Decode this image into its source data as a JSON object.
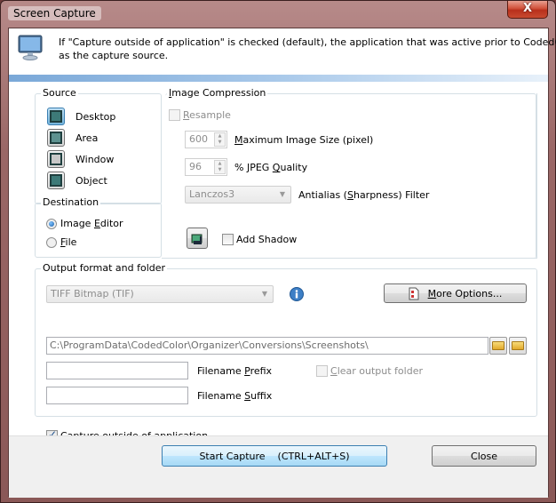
{
  "window": {
    "title": "Screen Capture",
    "close_label": "X"
  },
  "header": {
    "icon": "monitor-icon",
    "line1": "If \"Capture outside of application\" is checked (default), the application that was active prior to CodedColor is used",
    "line2": "as the capture source."
  },
  "source": {
    "label": "Source",
    "items": [
      {
        "label": "Desktop",
        "icon": "desktop-capture-icon",
        "active": true
      },
      {
        "label": "Area",
        "icon": "area-capture-icon",
        "active": false
      },
      {
        "label": "Window",
        "icon": "window-capture-icon",
        "active": false
      },
      {
        "label": "Object",
        "icon": "object-capture-icon",
        "active": false
      }
    ]
  },
  "destination": {
    "label": "Destination",
    "options": [
      {
        "label_pre": "Image ",
        "label_u": "E",
        "label_post": "ditor",
        "checked": true
      },
      {
        "label_pre": "",
        "label_u": "F",
        "label_post": "ile",
        "checked": false
      }
    ]
  },
  "compression": {
    "label_u": "I",
    "label_post": "mage Compression",
    "resample": {
      "label_u": "R",
      "label_post": "esample",
      "checked": false,
      "disabled": true
    },
    "max_size": {
      "value": "600",
      "label_u": "M",
      "label_post": "aximum Image Size (pixel)"
    },
    "jpeg_quality": {
      "value": "96",
      "label_pre": "% JPEG ",
      "label_u": "Q",
      "label_post": "uality"
    },
    "filter": {
      "value": "Lanczos3",
      "label_pre": "Antialias (",
      "label_u": "S",
      "label_post": "harpness) Filter"
    },
    "shadow_button_icon": "image-icon",
    "add_shadow": {
      "label": "Add Shadow",
      "checked": false
    }
  },
  "output": {
    "label": "Output format and folder",
    "format": "TIFF Bitmap (TIF)",
    "info_icon": "info-icon",
    "more_options": {
      "label_u": "M",
      "label_post": "ore Options...",
      "icon": "options-icon"
    },
    "folder_path": "C:\\ProgramData\\CodedColor\\Organizer\\Conversions\\Screenshots\\",
    "browse_icon": "folder-open-icon",
    "new_folder_icon": "folder-new-icon",
    "prefix": {
      "value": "",
      "label_pre": "Filename ",
      "label_u": "P",
      "label_post": "refix"
    },
    "suffix": {
      "value": "",
      "label_pre": "Filename ",
      "label_u": "S",
      "label_post": "uffix"
    },
    "clear_folder": {
      "label_u": "C",
      "label_post": "lear output folder",
      "checked": false,
      "disabled": true
    }
  },
  "capture_outside": {
    "label": "Capture outside of application",
    "checked": true
  },
  "footer": {
    "start_label": "Start Capture    (CTRL+ALT+S)",
    "close_label": "Close"
  }
}
